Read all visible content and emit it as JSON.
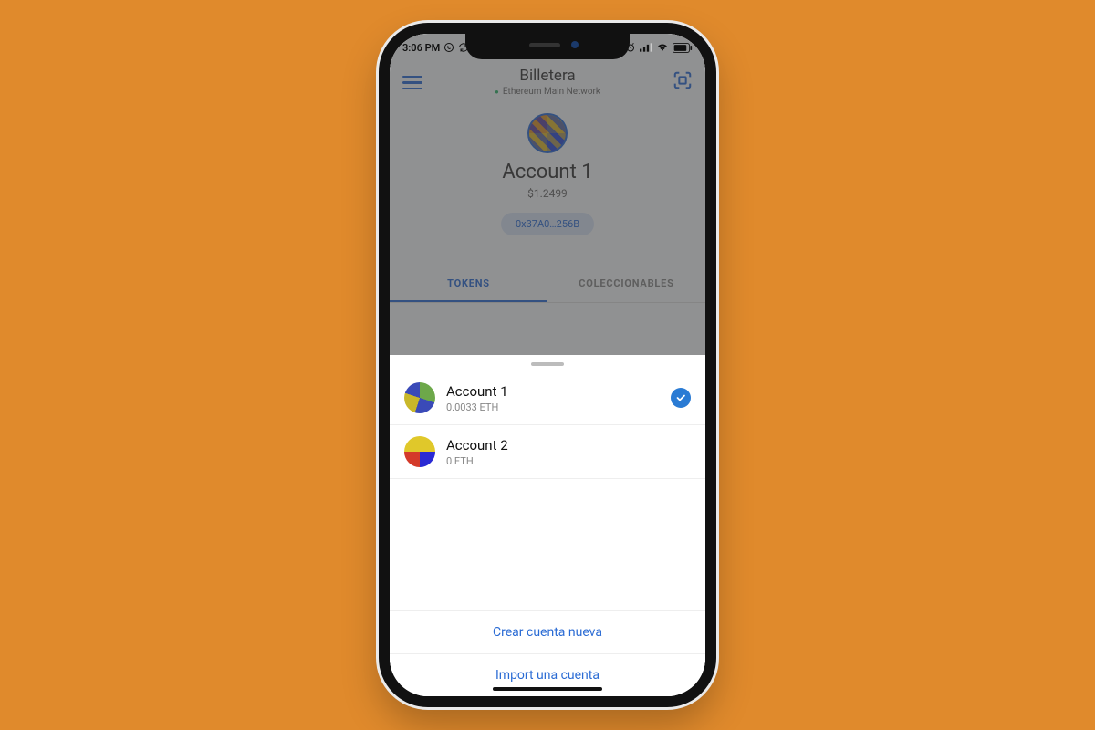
{
  "status_bar": {
    "time": "3:06 PM"
  },
  "header": {
    "title": "Billetera",
    "network": "Ethereum Main Network"
  },
  "main_account": {
    "name": "Account 1",
    "balance_fiat": "$1.2499",
    "address": "0x37A0…256B"
  },
  "tabs": {
    "tokens": "TOKENS",
    "collectibles": "COLECCIONABLES"
  },
  "sheet": {
    "accounts": [
      {
        "name": "Account 1",
        "balance": "0.0033 ETH",
        "selected": true
      },
      {
        "name": "Account 2",
        "balance": "0 ETH",
        "selected": false
      }
    ],
    "create_label": "Crear cuenta nueva",
    "import_label": "Import una cuenta"
  }
}
